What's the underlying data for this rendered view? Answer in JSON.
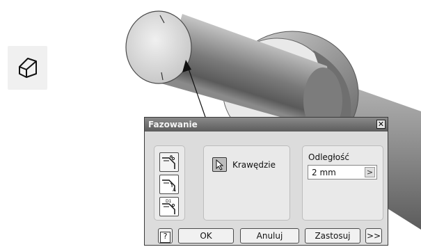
{
  "dialog": {
    "title": "Fazowanie",
    "close_symbol": "✕",
    "edges_label": "Krawędzie",
    "distance_label": "Odległość",
    "distance_value": "2 mm",
    "distance_arrow": ">",
    "help_symbol": "?",
    "ok_label": "OK",
    "cancel_label": "Anuluj",
    "apply_label": "Zastosuj",
    "more_label": ">>"
  },
  "icons": {
    "tool": "chamfer-tool-icon",
    "edge_select": "cursor-arrow-icon",
    "mode_buttons": [
      "chamfer-distance-icon",
      "chamfer-distance-angle-icon",
      "chamfer-two-distances-icon"
    ]
  },
  "colors": {
    "titlebar": "#6e6e6e",
    "dialog_bg": "#dcdcdc",
    "panel_bg": "#e9e9e9"
  }
}
